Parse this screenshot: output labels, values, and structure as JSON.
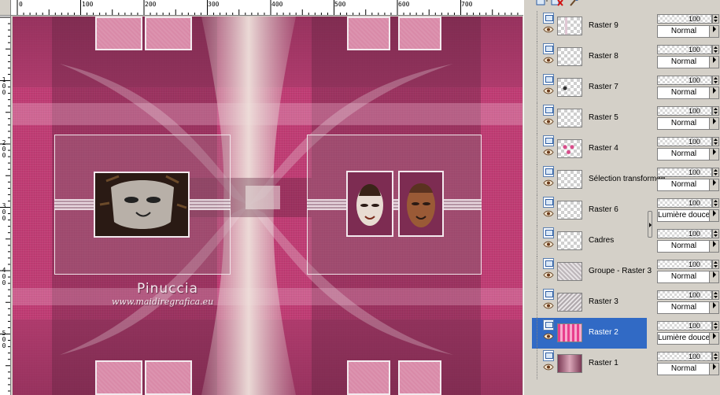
{
  "ruler": {
    "top_labels": [
      "0",
      "100",
      "200",
      "300",
      "400",
      "500",
      "600",
      "700"
    ],
    "left_labels": [
      "1\n0\n0",
      "2\n0\n0",
      "3\n0\n0",
      "4\n0\n0",
      "5\n0\n0"
    ]
  },
  "watermark": {
    "name": "Pinuccia",
    "url": "www.maidiregrafica.eu"
  },
  "layers": [
    {
      "name": "Raster 9",
      "thumb": "frames-top",
      "selected": false
    },
    {
      "name": "Raster 8",
      "thumb": "transparent",
      "selected": false
    },
    {
      "name": "Raster 7",
      "thumb": "small-mark",
      "selected": false
    },
    {
      "name": "Raster 5",
      "thumb": "transparent",
      "selected": false
    },
    {
      "name": "Raster 4",
      "thumb": "pink-dots",
      "selected": false
    },
    {
      "name": "Sélection transformée",
      "thumb": "transparent",
      "selected": false
    },
    {
      "name": "Raster 6",
      "thumb": "transparent",
      "selected": false
    },
    {
      "name": "Cadres",
      "thumb": "transparent",
      "selected": false
    },
    {
      "name": "Groupe - Raster 3",
      "thumb": "grey-pattern",
      "selected": false
    },
    {
      "name": "Raster 3",
      "thumb": "grey-pattern-2",
      "selected": false
    },
    {
      "name": "Raster 2",
      "thumb": "pink-stripes",
      "selected": true
    },
    {
      "name": "Raster 1",
      "thumb": "mauve-gradient",
      "selected": false
    }
  ],
  "properties": [
    {
      "opacity": "100",
      "blend": "Normal"
    },
    {
      "opacity": "100",
      "blend": "Normal"
    },
    {
      "opacity": "100",
      "blend": "Normal"
    },
    {
      "opacity": "100",
      "blend": "Normal"
    },
    {
      "opacity": "100",
      "blend": "Normal"
    },
    {
      "opacity": "100",
      "blend": "Normal"
    },
    {
      "opacity": "100",
      "blend": "Lumière douce"
    },
    {
      "opacity": "100",
      "blend": "Normal"
    },
    {
      "opacity": "100",
      "blend": "Normal"
    },
    {
      "opacity": "100",
      "blend": "Normal"
    },
    {
      "opacity": "100",
      "blend": "Lumière douce"
    },
    {
      "opacity": "100",
      "blend": "Normal"
    }
  ],
  "colors": {
    "canvas_pink": "#c03c74",
    "canvas_dark": "#7b2b4c",
    "center_cream": "#e9d8d6",
    "selection_blue": "#316ac5",
    "panel_grey": "#d4d0c8"
  },
  "icons": [
    "eye-icon",
    "layer-icon",
    "new-layer-icon",
    "delete-layer-icon",
    "brush-icon"
  ]
}
